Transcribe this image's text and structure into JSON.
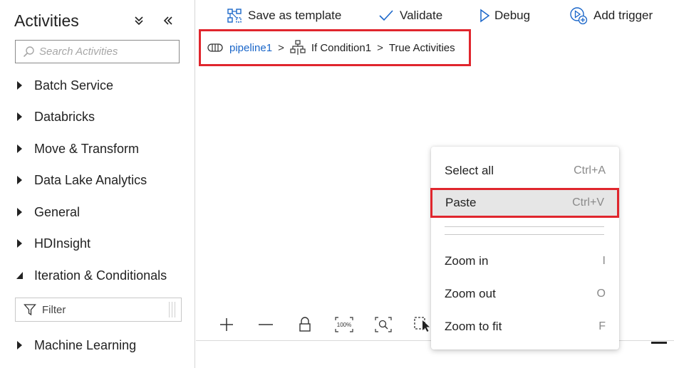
{
  "sidebar": {
    "title": "Activities",
    "search_placeholder": "Search Activities",
    "categories": [
      {
        "label": "Batch Service",
        "expanded": false
      },
      {
        "label": "Databricks",
        "expanded": false
      },
      {
        "label": "Move & Transform",
        "expanded": false
      },
      {
        "label": "Data Lake Analytics",
        "expanded": false
      },
      {
        "label": "General",
        "expanded": false
      },
      {
        "label": "HDInsight",
        "expanded": false
      },
      {
        "label": "Iteration & Conditionals",
        "expanded": true
      },
      {
        "label": "Machine Learning",
        "expanded": false
      }
    ],
    "filter_placeholder": "Filter"
  },
  "toolbar": {
    "save_template": "Save as template",
    "validate": "Validate",
    "debug": "Debug",
    "add_trigger": "Add trigger"
  },
  "breadcrumb": {
    "pipeline": "pipeline1",
    "sep": ">",
    "condition": "If Condition1",
    "activities": "True Activities"
  },
  "canvas_controls": {
    "zoom_reset_label": "100%"
  },
  "context_menu": {
    "items": [
      {
        "label": "Select all",
        "shortcut": "Ctrl+A"
      },
      {
        "label": "Paste",
        "shortcut": "Ctrl+V"
      },
      {
        "label": "Zoom in",
        "shortcut": "I"
      },
      {
        "label": "Zoom out",
        "shortcut": "O"
      },
      {
        "label": "Zoom to fit",
        "shortcut": "F"
      }
    ]
  },
  "colors": {
    "highlight_border": "#e0262d",
    "link": "#1a66c9",
    "accent_icon": "#1a66c9"
  },
  "icons": [
    "search-icon",
    "collapse-all-icon",
    "collapse-panel-icon",
    "caret-right-icon",
    "caret-down-icon",
    "filter-icon",
    "save-template-icon",
    "checkmark-icon",
    "play-icon",
    "add-trigger-icon",
    "pipeline-icon",
    "if-condition-icon",
    "plus-icon",
    "minus-icon",
    "lock-icon",
    "zoom-100-icon",
    "zoom-fit-icon",
    "select-icon",
    "cursor-icon"
  ]
}
